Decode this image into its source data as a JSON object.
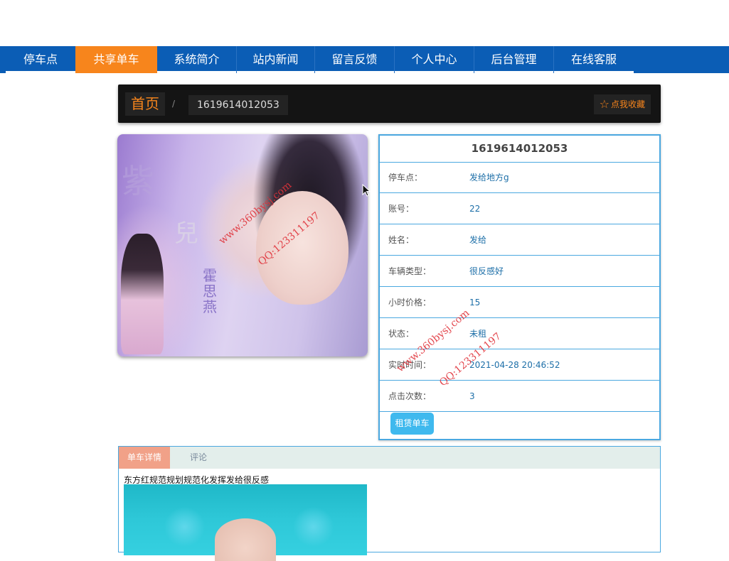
{
  "nav": {
    "items": [
      {
        "label": "停车点"
      },
      {
        "label": "共享单车",
        "active": true
      },
      {
        "label": "系统简介"
      },
      {
        "label": "站内新闻"
      },
      {
        "label": "留言反馈"
      },
      {
        "label": "个人中心"
      },
      {
        "label": "后台管理"
      },
      {
        "label": "在线客服"
      }
    ]
  },
  "breadcrumb": {
    "home": "首页",
    "separator": "/",
    "current": "1619614012053",
    "favorite_label": "点我收藏",
    "favorite_icon": "star-icon"
  },
  "photo": {
    "text_1": "紫",
    "text_2": "兒",
    "text_3": "霍思燕"
  },
  "info": {
    "title": "1619614012053",
    "rows": [
      {
        "label": "停车点：",
        "value": "发给地方g"
      },
      {
        "label": "账号：",
        "value": "22"
      },
      {
        "label": "姓名：",
        "value": "发给"
      },
      {
        "label": "车辆类型：",
        "value": "很反感好"
      },
      {
        "label": "小时价格：",
        "value": "15"
      },
      {
        "label": "状态：",
        "value": "未租"
      },
      {
        "label": "实时时间：",
        "value": "2021-04-28 20:46:52"
      },
      {
        "label": "点击次数：",
        "value": "3"
      }
    ],
    "rent_button": "租赁单车"
  },
  "watermark": {
    "site": "www.360bysj.com",
    "qq": "QQ:123311197"
  },
  "detail": {
    "tab_active": "单车详情",
    "tab_comment": "评论",
    "text": "东方红规范规划规范化发挥发给很反感"
  },
  "colors": {
    "nav_bg": "#0b5db5",
    "nav_active": "#f7851c",
    "table_border": "#4aa8e0",
    "button": "#3fb9ee"
  }
}
